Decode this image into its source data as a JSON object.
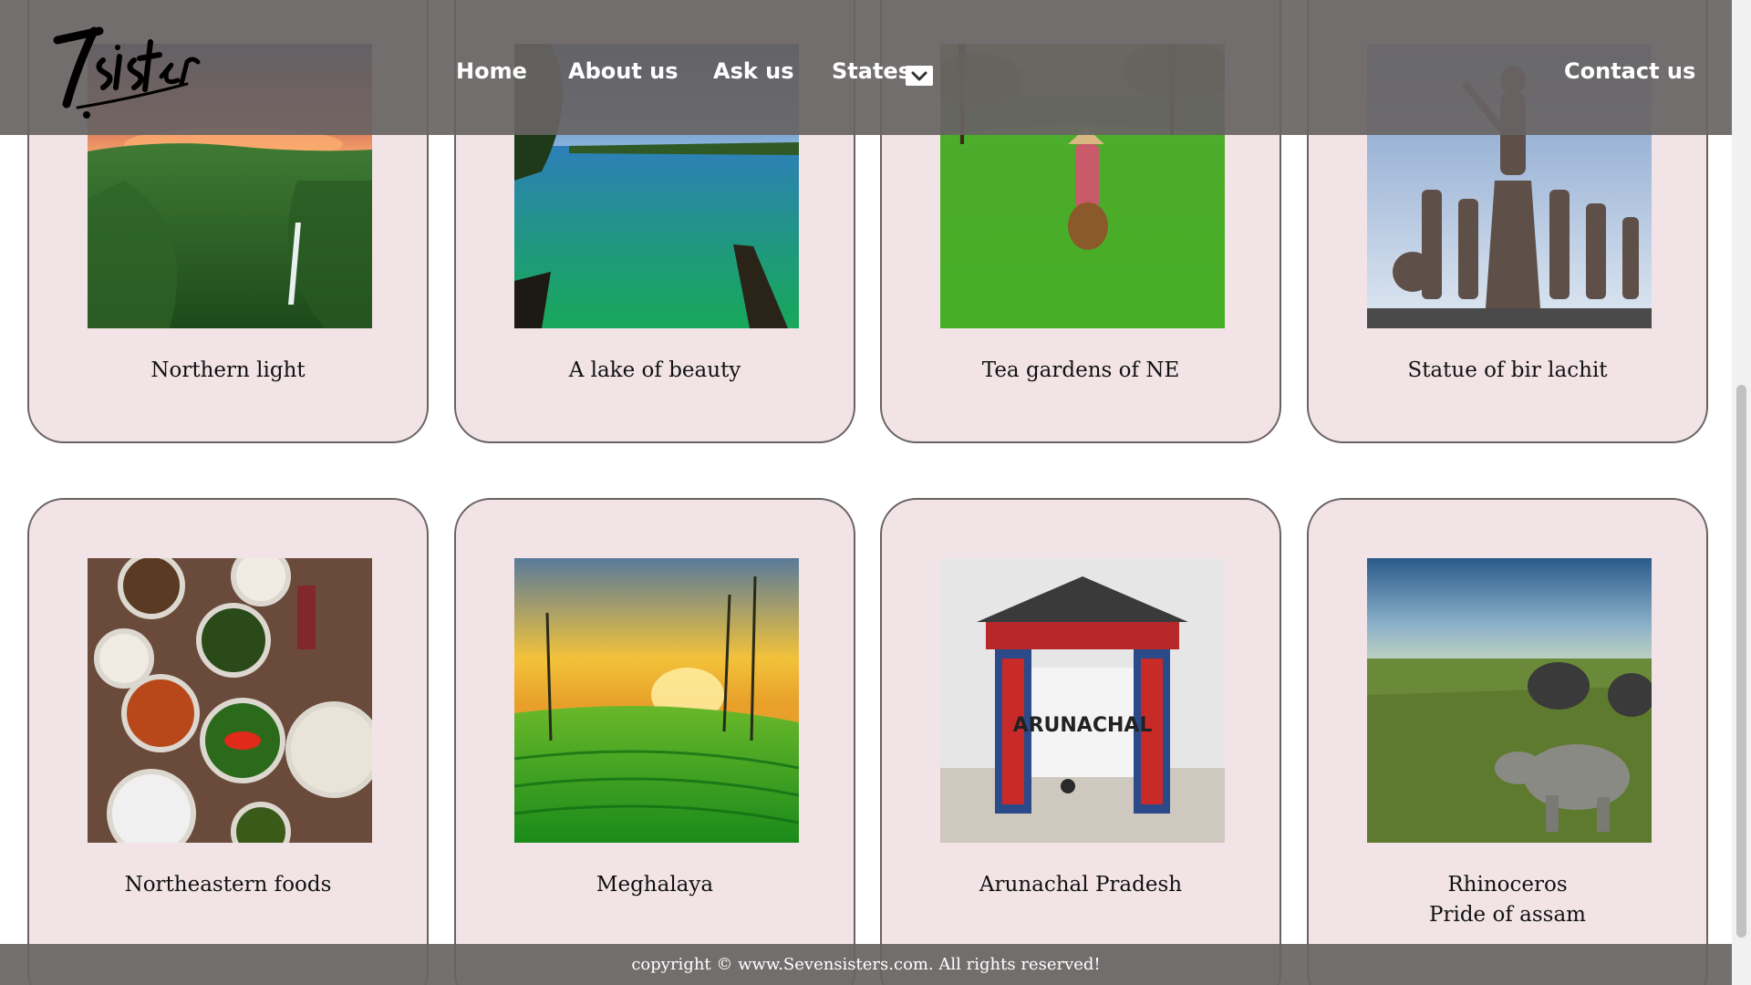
{
  "header": {
    "logo_alt": "7sisters",
    "nav": {
      "home": "Home",
      "about": "About us",
      "ask": "Ask us",
      "states": "States",
      "contact": "Contact us"
    }
  },
  "cards": [
    {
      "caption": "Northern light",
      "image": "waterfall-valley-sunset"
    },
    {
      "caption": "A lake of beauty",
      "image": "lake-with-boats"
    },
    {
      "caption": "Tea gardens of NE",
      "image": "tea-plucker"
    },
    {
      "caption": "Statue of bir lachit",
      "image": "warrior-statue"
    },
    {
      "caption": "Northeastern foods",
      "image": "food-platter"
    },
    {
      "caption": "Meghalaya",
      "image": "green-terraces-sunset"
    },
    {
      "caption": "Arunachal Pradesh",
      "image": "arunachal-gate"
    },
    {
      "caption_line1": "Rhinoceros",
      "caption_line2": "Pride of assam",
      "image": "rhino-grassland"
    }
  ],
  "footer": {
    "copyright": "copyright © www.Sevensisters.com. All rights reserved!"
  },
  "colors": {
    "header_bg": "#686464",
    "card_bg": "#f2e4e6",
    "card_border": "#6a6262",
    "nav_text": "#ffffff"
  }
}
